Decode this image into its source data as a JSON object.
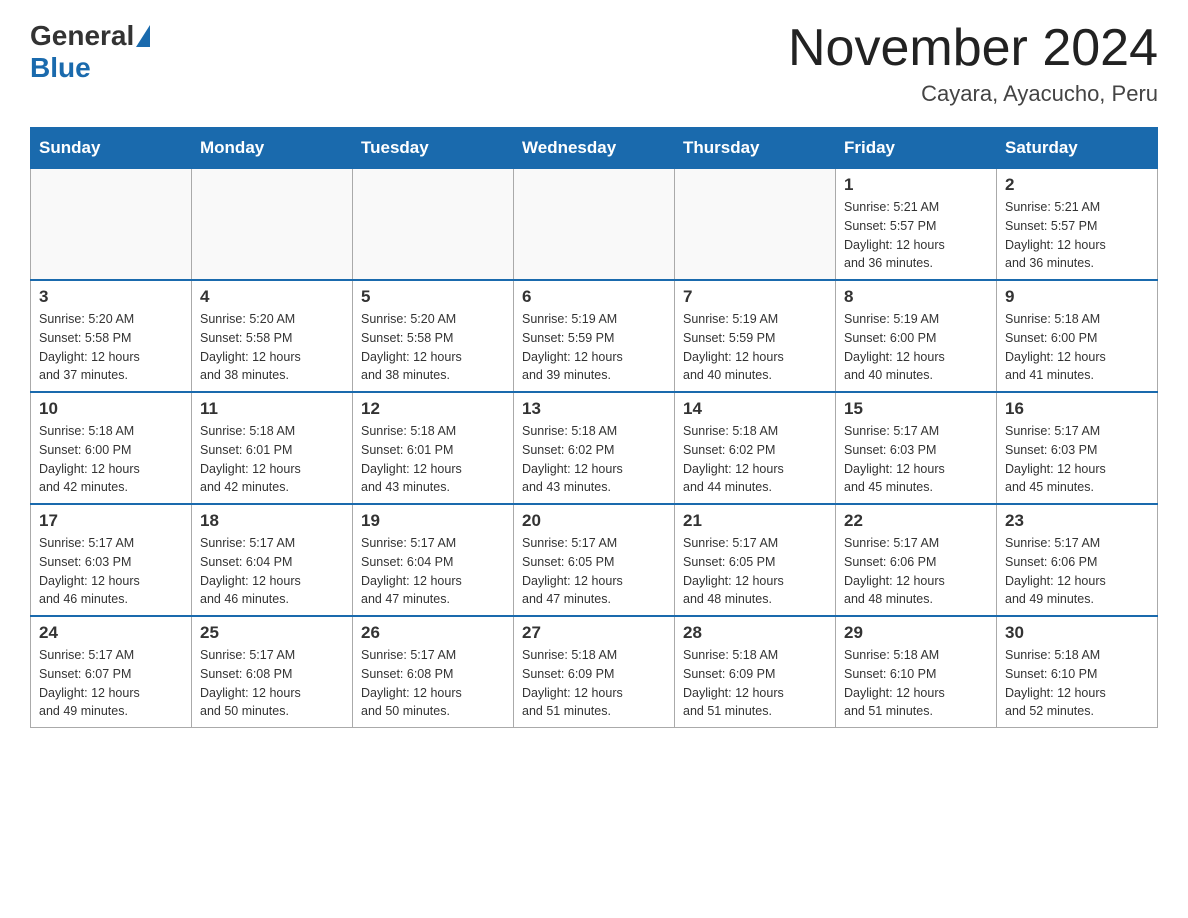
{
  "header": {
    "logo_general": "General",
    "logo_blue": "Blue",
    "title": "November 2024",
    "subtitle": "Cayara, Ayacucho, Peru"
  },
  "days_of_week": [
    "Sunday",
    "Monday",
    "Tuesday",
    "Wednesday",
    "Thursday",
    "Friday",
    "Saturday"
  ],
  "weeks": [
    {
      "days": [
        {
          "number": "",
          "info": ""
        },
        {
          "number": "",
          "info": ""
        },
        {
          "number": "",
          "info": ""
        },
        {
          "number": "",
          "info": ""
        },
        {
          "number": "",
          "info": ""
        },
        {
          "number": "1",
          "info": "Sunrise: 5:21 AM\nSunset: 5:57 PM\nDaylight: 12 hours\nand 36 minutes."
        },
        {
          "number": "2",
          "info": "Sunrise: 5:21 AM\nSunset: 5:57 PM\nDaylight: 12 hours\nand 36 minutes."
        }
      ]
    },
    {
      "days": [
        {
          "number": "3",
          "info": "Sunrise: 5:20 AM\nSunset: 5:58 PM\nDaylight: 12 hours\nand 37 minutes."
        },
        {
          "number": "4",
          "info": "Sunrise: 5:20 AM\nSunset: 5:58 PM\nDaylight: 12 hours\nand 38 minutes."
        },
        {
          "number": "5",
          "info": "Sunrise: 5:20 AM\nSunset: 5:58 PM\nDaylight: 12 hours\nand 38 minutes."
        },
        {
          "number": "6",
          "info": "Sunrise: 5:19 AM\nSunset: 5:59 PM\nDaylight: 12 hours\nand 39 minutes."
        },
        {
          "number": "7",
          "info": "Sunrise: 5:19 AM\nSunset: 5:59 PM\nDaylight: 12 hours\nand 40 minutes."
        },
        {
          "number": "8",
          "info": "Sunrise: 5:19 AM\nSunset: 6:00 PM\nDaylight: 12 hours\nand 40 minutes."
        },
        {
          "number": "9",
          "info": "Sunrise: 5:18 AM\nSunset: 6:00 PM\nDaylight: 12 hours\nand 41 minutes."
        }
      ]
    },
    {
      "days": [
        {
          "number": "10",
          "info": "Sunrise: 5:18 AM\nSunset: 6:00 PM\nDaylight: 12 hours\nand 42 minutes."
        },
        {
          "number": "11",
          "info": "Sunrise: 5:18 AM\nSunset: 6:01 PM\nDaylight: 12 hours\nand 42 minutes."
        },
        {
          "number": "12",
          "info": "Sunrise: 5:18 AM\nSunset: 6:01 PM\nDaylight: 12 hours\nand 43 minutes."
        },
        {
          "number": "13",
          "info": "Sunrise: 5:18 AM\nSunset: 6:02 PM\nDaylight: 12 hours\nand 43 minutes."
        },
        {
          "number": "14",
          "info": "Sunrise: 5:18 AM\nSunset: 6:02 PM\nDaylight: 12 hours\nand 44 minutes."
        },
        {
          "number": "15",
          "info": "Sunrise: 5:17 AM\nSunset: 6:03 PM\nDaylight: 12 hours\nand 45 minutes."
        },
        {
          "number": "16",
          "info": "Sunrise: 5:17 AM\nSunset: 6:03 PM\nDaylight: 12 hours\nand 45 minutes."
        }
      ]
    },
    {
      "days": [
        {
          "number": "17",
          "info": "Sunrise: 5:17 AM\nSunset: 6:03 PM\nDaylight: 12 hours\nand 46 minutes."
        },
        {
          "number": "18",
          "info": "Sunrise: 5:17 AM\nSunset: 6:04 PM\nDaylight: 12 hours\nand 46 minutes."
        },
        {
          "number": "19",
          "info": "Sunrise: 5:17 AM\nSunset: 6:04 PM\nDaylight: 12 hours\nand 47 minutes."
        },
        {
          "number": "20",
          "info": "Sunrise: 5:17 AM\nSunset: 6:05 PM\nDaylight: 12 hours\nand 47 minutes."
        },
        {
          "number": "21",
          "info": "Sunrise: 5:17 AM\nSunset: 6:05 PM\nDaylight: 12 hours\nand 48 minutes."
        },
        {
          "number": "22",
          "info": "Sunrise: 5:17 AM\nSunset: 6:06 PM\nDaylight: 12 hours\nand 48 minutes."
        },
        {
          "number": "23",
          "info": "Sunrise: 5:17 AM\nSunset: 6:06 PM\nDaylight: 12 hours\nand 49 minutes."
        }
      ]
    },
    {
      "days": [
        {
          "number": "24",
          "info": "Sunrise: 5:17 AM\nSunset: 6:07 PM\nDaylight: 12 hours\nand 49 minutes."
        },
        {
          "number": "25",
          "info": "Sunrise: 5:17 AM\nSunset: 6:08 PM\nDaylight: 12 hours\nand 50 minutes."
        },
        {
          "number": "26",
          "info": "Sunrise: 5:17 AM\nSunset: 6:08 PM\nDaylight: 12 hours\nand 50 minutes."
        },
        {
          "number": "27",
          "info": "Sunrise: 5:18 AM\nSunset: 6:09 PM\nDaylight: 12 hours\nand 51 minutes."
        },
        {
          "number": "28",
          "info": "Sunrise: 5:18 AM\nSunset: 6:09 PM\nDaylight: 12 hours\nand 51 minutes."
        },
        {
          "number": "29",
          "info": "Sunrise: 5:18 AM\nSunset: 6:10 PM\nDaylight: 12 hours\nand 51 minutes."
        },
        {
          "number": "30",
          "info": "Sunrise: 5:18 AM\nSunset: 6:10 PM\nDaylight: 12 hours\nand 52 minutes."
        }
      ]
    }
  ]
}
